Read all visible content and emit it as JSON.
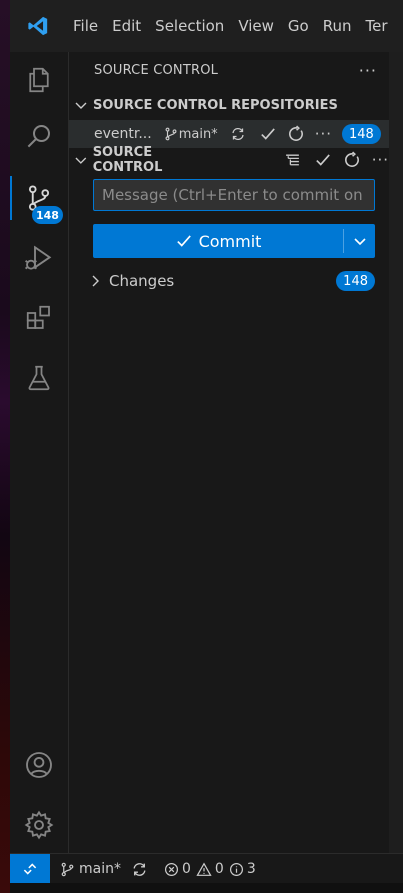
{
  "menu": [
    "File",
    "Edit",
    "Selection",
    "View",
    "Go",
    "Run",
    "Ter"
  ],
  "activity_bar": {
    "items": [
      "explorer-icon",
      "search-icon",
      "source-control-icon",
      "run-debug-icon",
      "extensions-icon",
      "testing-icon"
    ],
    "source_control_badge": "148",
    "bottom": [
      "accounts-icon",
      "manage-gear-icon"
    ]
  },
  "sidebar": {
    "title": "SOURCE CONTROL",
    "repositories_header": "SOURCE CONTROL REPOSITORIES",
    "repo": {
      "name": "eventr...",
      "branch": "main*",
      "count": "148"
    },
    "source_control_header": "SOURCE CONTROL",
    "message_placeholder": "Message (Ctrl+Enter to commit on ...",
    "commit_label": "Commit",
    "changes_label": "Changes",
    "changes_count": "148"
  },
  "statusbar": {
    "branch": "main*",
    "errors": "0",
    "warnings": "0",
    "info": "3"
  },
  "colors": {
    "accent": "#0078d4",
    "background": "#181818",
    "text": "#cccccc"
  }
}
